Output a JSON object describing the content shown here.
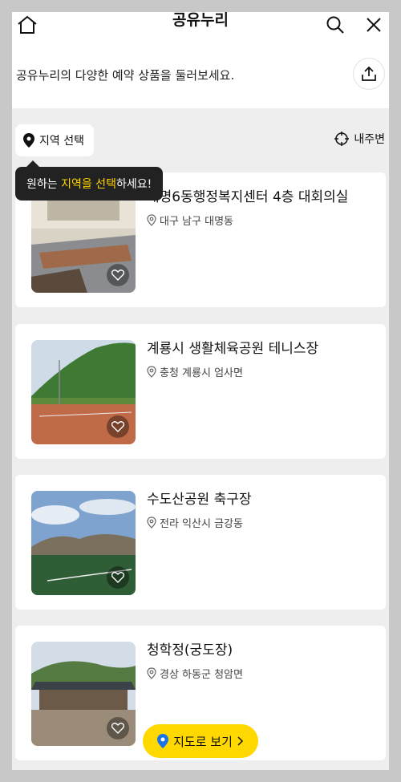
{
  "header": {
    "title": "공유누리",
    "subtitle": "공유누리의 다양한 예약 상품을 둘러보세요.",
    "home_icon": "home-icon",
    "search_icon": "search-icon",
    "close_icon": "close-icon",
    "share_icon": "share-icon"
  },
  "toolbar": {
    "region_label": "지역 선택",
    "near_label": "내주변"
  },
  "tooltip": {
    "prefix": "원하는 ",
    "highlight": "지역을 선택",
    "suffix": "하세요!"
  },
  "cards": [
    {
      "title": "대명6동행정복지센터 4층 대회의실",
      "location": "대구 남구 대명동"
    },
    {
      "title": "계룡시 생활체육공원 테니스장",
      "location": "충청 계룡시 엄사면"
    },
    {
      "title": "수도산공원 축구장",
      "location": "전라 익산시 금강동"
    },
    {
      "title": "청학정(궁도장)",
      "location": "경상 하동군 청암면"
    }
  ],
  "map_button": {
    "label": "지도로 보기"
  },
  "colors": {
    "accent": "#ffd800",
    "tooltip_highlight": "#ffd400",
    "pin_blue": "#1a73e8"
  }
}
